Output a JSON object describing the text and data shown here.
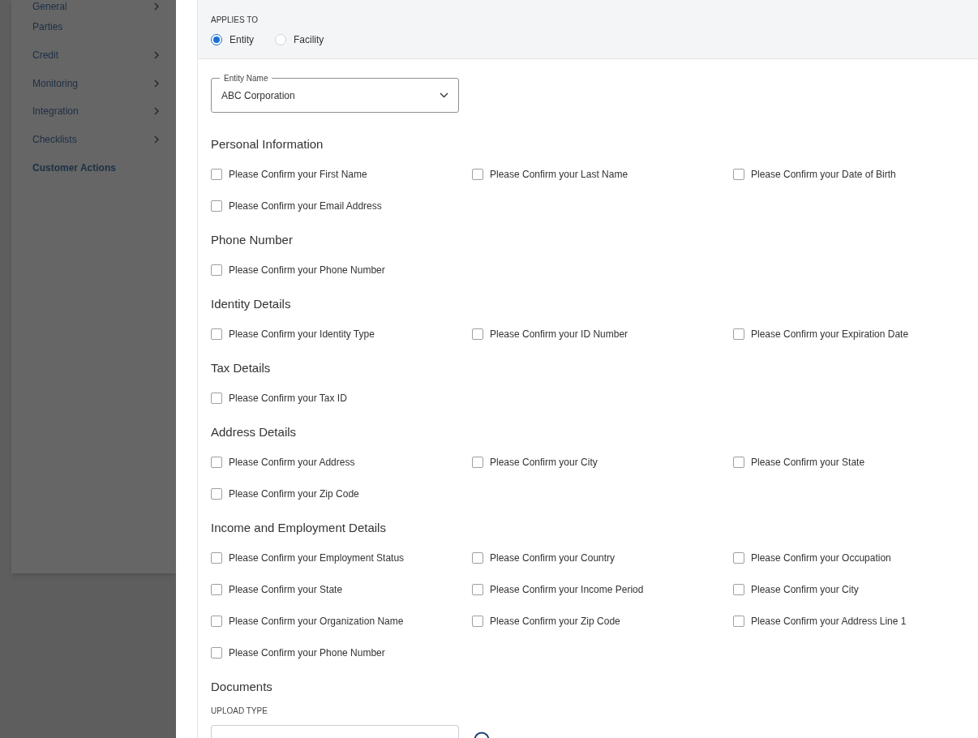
{
  "sidebar": {
    "items": [
      {
        "label": "General",
        "expandable": true,
        "selected": false
      },
      {
        "label": "Parties",
        "expandable": false,
        "selected": false
      },
      {
        "label": "Credit",
        "expandable": true,
        "selected": false
      },
      {
        "label": "Monitoring",
        "expandable": true,
        "selected": false
      },
      {
        "label": "Integration",
        "expandable": true,
        "selected": false
      },
      {
        "label": "Checklists",
        "expandable": true,
        "selected": false
      },
      {
        "label": "Customer Actions",
        "expandable": false,
        "selected": true
      }
    ]
  },
  "applies_to": {
    "label": "APPLIES TO",
    "options": [
      {
        "label": "Entity",
        "selected": true
      },
      {
        "label": "Facility",
        "selected": false
      }
    ]
  },
  "entity_name": {
    "label": "Entity Name",
    "value": "ABC Corporation"
  },
  "sections": [
    {
      "title": "Personal Information",
      "items": [
        {
          "label": "Please Confirm your First Name",
          "checked": false
        },
        {
          "label": "Please Confirm your Last Name",
          "checked": false
        },
        {
          "label": "Please Confirm your Date of Birth",
          "checked": false
        },
        {
          "label": "Please Confirm your Email Address",
          "checked": false
        }
      ]
    },
    {
      "title": "Phone Number",
      "items": [
        {
          "label": "Please Confirm your Phone Number",
          "checked": false
        }
      ]
    },
    {
      "title": "Identity Details",
      "items": [
        {
          "label": "Please Confirm your Identity Type",
          "checked": false
        },
        {
          "label": "Please Confirm your ID Number",
          "checked": false
        },
        {
          "label": "Please Confirm your Expiration Date",
          "checked": false
        }
      ]
    },
    {
      "title": "Tax Details",
      "items": [
        {
          "label": "Please Confirm your Tax ID",
          "checked": false
        }
      ]
    },
    {
      "title": "Address Details",
      "items": [
        {
          "label": "Please Confirm your Address",
          "checked": false
        },
        {
          "label": "Please Confirm your City",
          "checked": false
        },
        {
          "label": "Please Confirm your State",
          "checked": false
        },
        {
          "label": "Please Confirm your Zip Code",
          "checked": false
        }
      ]
    },
    {
      "title": "Income and Employment Details",
      "items": [
        {
          "label": "Please Confirm your Employment Status",
          "checked": false
        },
        {
          "label": "Please Confirm your Country",
          "checked": false
        },
        {
          "label": "Please Confirm your Occupation",
          "checked": false
        },
        {
          "label": "Please Confirm your State",
          "checked": false
        },
        {
          "label": "Please Confirm your Income Period",
          "checked": false
        },
        {
          "label": "Please Confirm your City",
          "checked": false
        },
        {
          "label": "Please Confirm your Organization Name",
          "checked": false
        },
        {
          "label": "Please Confirm your Zip Code",
          "checked": false
        },
        {
          "label": "Please Confirm your Address Line 1",
          "checked": false
        },
        {
          "label": "Please Confirm your Phone Number",
          "checked": false
        }
      ]
    }
  ],
  "documents": {
    "title": "Documents",
    "upload_type_label": "UPLOAD TYPE"
  }
}
